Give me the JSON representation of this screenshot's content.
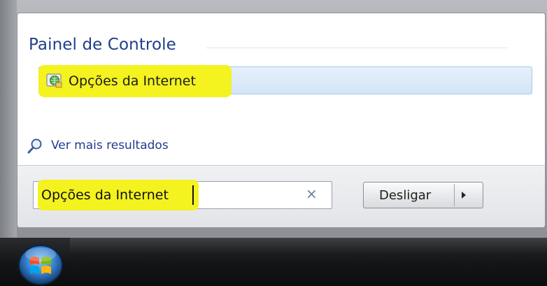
{
  "results_panel": {
    "heading": "Painel de Controle",
    "result_item_label": "Opções da Internet",
    "see_more_label": "Ver mais resultados"
  },
  "search": {
    "value": "Opções da Internet",
    "clear_glyph": "×"
  },
  "shutdown": {
    "label": "Desligar"
  },
  "icons": {
    "result_item": "internet-options-icon",
    "see_more": "search-icon",
    "clear": "close-icon",
    "shutdown_options": "chevron-right-icon",
    "start": "windows-start-orb-icon"
  },
  "colors": {
    "heading": "#1e3e8c",
    "highlight": "#f4f21f",
    "selection": "#d3e5f8",
    "taskbar": "#151618"
  }
}
